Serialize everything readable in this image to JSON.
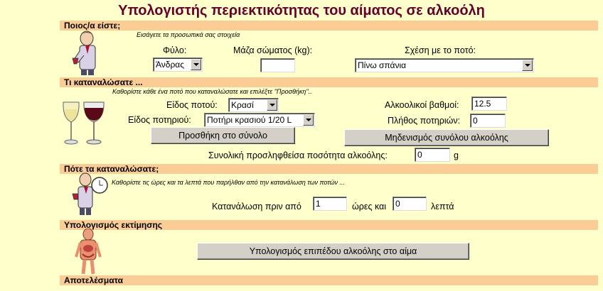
{
  "title": "Υπολογιστής περιεκτικότητας του αίματος σε αλκοόλη",
  "section1": {
    "header": "Ποιος/α είστε;",
    "hint": "Εισάγετε τα προσωπικά σας στοιχεία",
    "gender_label": "Φύλο:",
    "gender_value": "Άνδρας",
    "weight_label": "Μάζα σώματος (kg):",
    "weight_value": "",
    "drinking_label": "Σχέση με το ποτό:",
    "drinking_value": "Πίνω σπάνια"
  },
  "section2": {
    "header": "Τι καταναλώσατε ...",
    "hint": "Καθορίστε κάθε ένα ποτό που καταναλώσατε και επιλέξτε \"Προσθήκη\"..",
    "drink_type_label": "Είδος ποτού:",
    "drink_type_value": "Κρασί",
    "glass_type_label": "Είδος ποτηριού:",
    "glass_type_value": "Ποτήρι κρασιού 1/20 L",
    "abv_label": "Αλκοολικοί βαθμοί:",
    "abv_value": "12.5",
    "glass_count_label": "Πλήθος ποτηριών:",
    "glass_count_value": "0",
    "add_button": "Προσθήκη στο σύνολο",
    "reset_button": "Μηδενισμός συνόλου αλκοόλης",
    "total_label": "Συνολική προσληφθείσα ποσότητα αλκοόλης:",
    "total_value": "0",
    "total_unit": "g"
  },
  "section3": {
    "header": "Πότε τα καταναλώσατε;",
    "hint": "Καθορίστε τις ώρες και τα λεπτά που παρήλθαν από την κατανάλωση των ποτών ...",
    "consumption_label": "Κατανάλωση πριν από",
    "hours_value": "1",
    "hours_label": "ώρες και",
    "minutes_value": "0",
    "minutes_label": "λεπτά"
  },
  "section4": {
    "header": "Υπολογισμός εκτίμησης",
    "calc_button": "Υπολογισμός επιπέδου αλκοόλης στο αίμα"
  },
  "section5": {
    "header": "Αποτελέσματα"
  },
  "colors": {
    "title": "#66002a",
    "section_bar": "#f9cd95",
    "background": "#ffffcc",
    "button_face": "#d4d0c8"
  }
}
